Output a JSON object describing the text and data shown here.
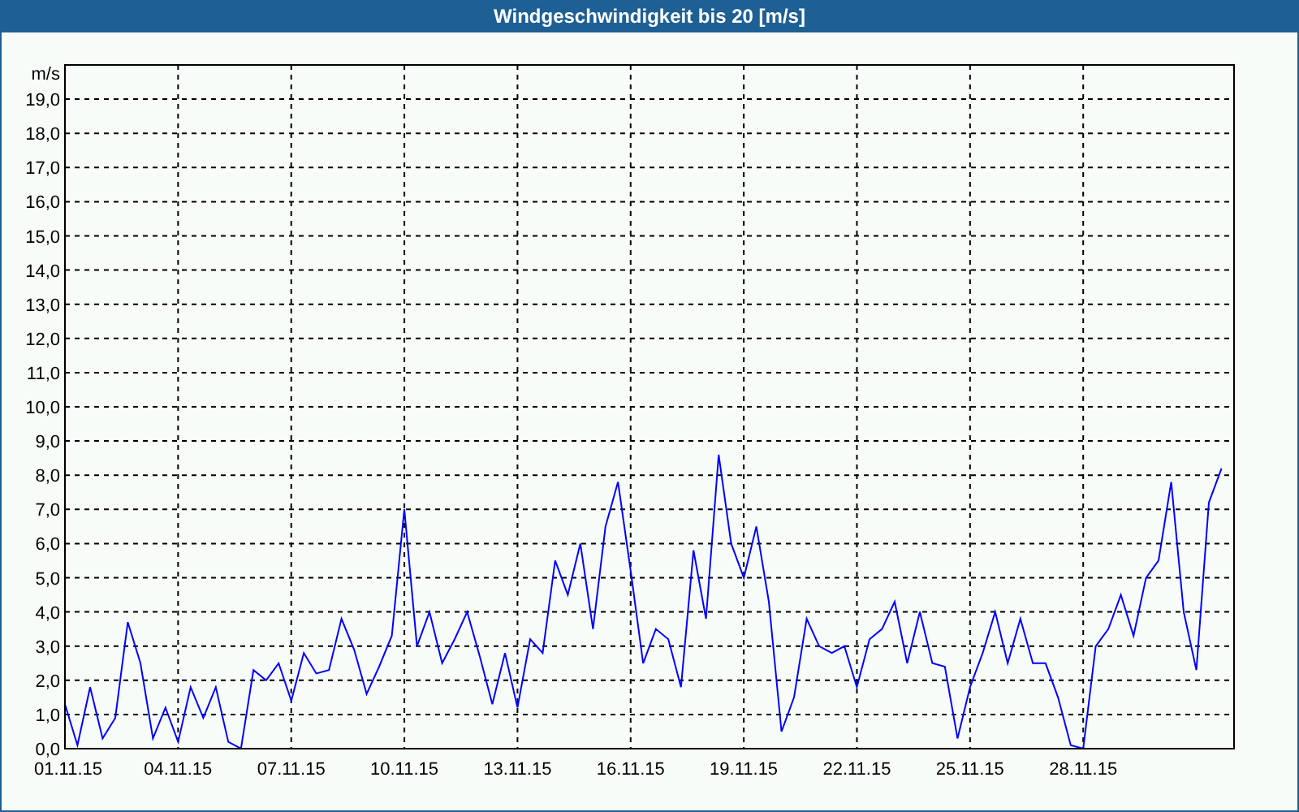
{
  "window": {
    "title": "Windgeschwindigkeit bis 20 [m/s]"
  },
  "chart": {
    "chart_data": {
      "type": "line",
      "grid": true,
      "ylabel": "m/s",
      "ylim": [
        0,
        20
      ],
      "yticks": [
        {
          "value": 0,
          "label": "0,0"
        },
        {
          "value": 1,
          "label": "1,0"
        },
        {
          "value": 2,
          "label": "2,0"
        },
        {
          "value": 3,
          "label": "3,0"
        },
        {
          "value": 4,
          "label": "4,0"
        },
        {
          "value": 5,
          "label": "5,0"
        },
        {
          "value": 6,
          "label": "6,0"
        },
        {
          "value": 7,
          "label": "7,0"
        },
        {
          "value": 8,
          "label": "8,0"
        },
        {
          "value": 9,
          "label": "9,0"
        },
        {
          "value": 10,
          "label": "10,0"
        },
        {
          "value": 11,
          "label": "11,0"
        },
        {
          "value": 12,
          "label": "12,0"
        },
        {
          "value": 13,
          "label": "13,0"
        },
        {
          "value": 14,
          "label": "14,0"
        },
        {
          "value": 15,
          "label": "15,0"
        },
        {
          "value": 16,
          "label": "16,0"
        },
        {
          "value": 17,
          "label": "17,0"
        },
        {
          "value": 18,
          "label": "18,0"
        },
        {
          "value": 19,
          "label": "19,0"
        }
      ],
      "categories": [
        "01.11.15",
        null,
        null,
        null,
        null,
        null,
        null,
        null,
        null,
        "04.11.15",
        null,
        null,
        null,
        null,
        null,
        null,
        null,
        null,
        "07.11.15",
        null,
        null,
        null,
        null,
        null,
        null,
        null,
        null,
        "10.11.15",
        null,
        null,
        null,
        null,
        null,
        null,
        null,
        null,
        "13.11.15",
        null,
        null,
        null,
        null,
        null,
        null,
        null,
        null,
        "16.11.15",
        null,
        null,
        null,
        null,
        null,
        null,
        null,
        null,
        "19.11.15",
        null,
        null,
        null,
        null,
        null,
        null,
        null,
        null,
        "22.11.15",
        null,
        null,
        null,
        null,
        null,
        null,
        null,
        null,
        "25.11.15",
        null,
        null,
        null,
        null,
        null,
        null,
        null,
        null,
        "28.11.15",
        null,
        null,
        null,
        null,
        null,
        null,
        null,
        null,
        null,
        null,
        null
      ],
      "series": [
        {
          "color": "#0000ff",
          "values": [
            1.3,
            0.1,
            1.8,
            0.3,
            0.9,
            3.7,
            2.5,
            0.3,
            1.2,
            0.2,
            1.8,
            0.9,
            1.8,
            0.2,
            0.0,
            2.3,
            2.0,
            2.5,
            1.4,
            2.8,
            2.2,
            2.3,
            3.8,
            2.9,
            1.6,
            2.4,
            3.3,
            7.0,
            3.0,
            4.0,
            2.5,
            3.2,
            4.0,
            2.7,
            1.3,
            2.8,
            1.2,
            3.2,
            2.8,
            5.5,
            4.5,
            6.0,
            3.5,
            6.5,
            7.8,
            5.2,
            2.5,
            3.5,
            3.2,
            1.8,
            5.8,
            3.8,
            8.6,
            6.0,
            5.0,
            6.5,
            4.3,
            0.5,
            1.5,
            3.8,
            3.0,
            2.8,
            3.0,
            1.8,
            3.2,
            3.5,
            4.3,
            2.5,
            4.0,
            2.5,
            2.4,
            0.3,
            1.8,
            2.8,
            4.0,
            2.5,
            3.8,
            2.5,
            2.5,
            1.5,
            0.1,
            0.0,
            3.0,
            3.5,
            4.5,
            3.3,
            5.0,
            5.5,
            7.8,
            4.0,
            2.3,
            7.2,
            8.2
          ]
        }
      ]
    }
  }
}
